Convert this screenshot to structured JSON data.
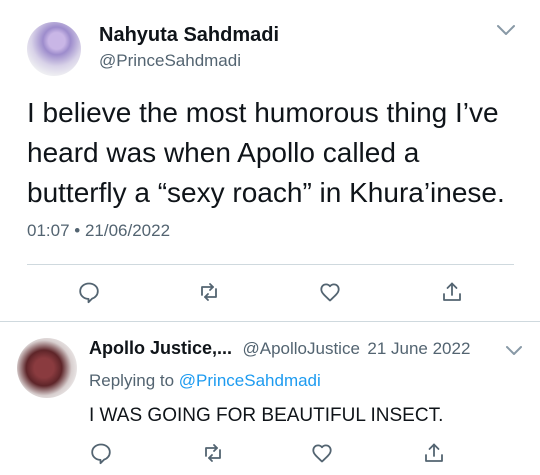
{
  "tweet": {
    "author_name": "Nahyuta Sahdmadi",
    "author_handle": "@PrinceSahdmadi",
    "text_lines": [
      "I believe the most humorous thing I’ve",
      "heard was when Apollo called a",
      "butterfly a “sexy roach” in Khura’inese."
    ],
    "timestamp": "01:07 • 21/06/2022"
  },
  "reply": {
    "author_name": "Apollo Justice,...",
    "author_handle": "@ApolloJustice",
    "date": "21 June 2022",
    "replying_to_label": "Replying to",
    "replying_to_handle": "@PrinceSahdmadi",
    "text": "I WAS GOING FOR BEAUTIFUL INSECT."
  },
  "icons": {
    "reply": "reply-icon",
    "retweet": "retweet-icon",
    "like": "heart-icon",
    "share": "share-icon",
    "more": "chevron-down-icon"
  },
  "colors": {
    "text": "#0f1419",
    "secondary": "#536471",
    "link": "#1d9bf0",
    "divider": "#cfd9de"
  }
}
